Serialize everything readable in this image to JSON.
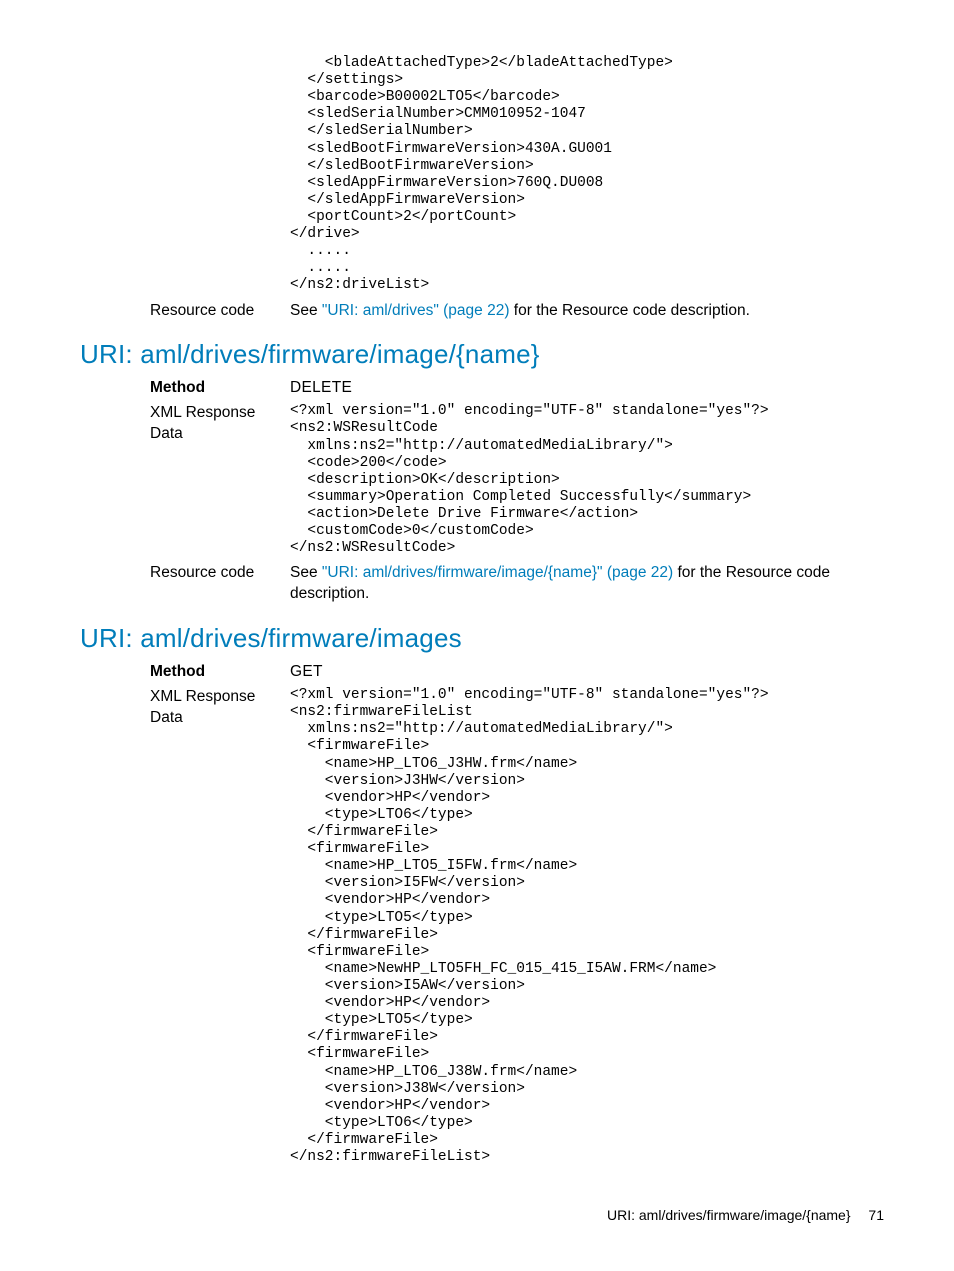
{
  "topCode": "    <bladeAttachedType>2</bladeAttachedType>\n  </settings>\n  <barcode>B00002LTO5</barcode>\n  <sledSerialNumber>CMM010952-1047\n  </sledSerialNumber>\n  <sledBootFirmwareVersion>430A.GU001\n  </sledBootFirmwareVersion>\n  <sledAppFirmwareVersion>760Q.DU008\n  </sledAppFirmwareVersion>\n  <portCount>2</portCount>\n</drive>\n  .....\n  .....\n</ns2:driveList>",
  "resourceCodeLabel": "Resource code",
  "topResource": {
    "prefix": "See ",
    "link": "\"URI: aml/drives\" (page 22)",
    "suffix": " for the Resource code description."
  },
  "section1": {
    "heading": "URI: aml/drives/firmware/image/{name}",
    "methodLabel": "Method",
    "methodValue": "DELETE",
    "xmlLabel": "XML Response Data",
    "xmlCode": "<?xml version=\"1.0\" encoding=\"UTF-8\" standalone=\"yes\"?>\n<ns2:WSResultCode\n  xmlns:ns2=\"http://automatedMediaLibrary/\">\n  <code>200</code>\n  <description>OK</description>\n  <summary>Operation Completed Successfully</summary>\n  <action>Delete Drive Firmware</action>\n  <customCode>0</customCode>\n</ns2:WSResultCode>",
    "resource": {
      "prefix": "See ",
      "link": "\"URI: aml/drives/firmware/image/{name}\" (page 22)",
      "suffix": " for the Resource code description."
    }
  },
  "section2": {
    "heading": "URI: aml/drives/firmware/images",
    "methodLabel": "Method",
    "methodValue": "GET",
    "xmlLabel": "XML Response Data",
    "xmlCode": "<?xml version=\"1.0\" encoding=\"UTF-8\" standalone=\"yes\"?>\n<ns2:firmwareFileList\n  xmlns:ns2=\"http://automatedMediaLibrary/\">\n  <firmwareFile>\n    <name>HP_LTO6_J3HW.frm</name>\n    <version>J3HW</version>\n    <vendor>HP</vendor>\n    <type>LTO6</type>\n  </firmwareFile>\n  <firmwareFile>\n    <name>HP_LTO5_I5FW.frm</name>\n    <version>I5FW</version>\n    <vendor>HP</vendor>\n    <type>LTO5</type>\n  </firmwareFile>\n  <firmwareFile>\n    <name>NewHP_LTO5FH_FC_015_415_I5AW.FRM</name>\n    <version>I5AW</version>\n    <vendor>HP</vendor>\n    <type>LTO5</type>\n  </firmwareFile>\n  <firmwareFile>\n    <name>HP_LTO6_J38W.frm</name>\n    <version>J38W</version>\n    <vendor>HP</vendor>\n    <type>LTO6</type>\n  </firmwareFile>\n</ns2:firmwareFileList>"
  },
  "footer": {
    "title": "URI: aml/drives/firmware/image/{name}",
    "page": "71"
  }
}
